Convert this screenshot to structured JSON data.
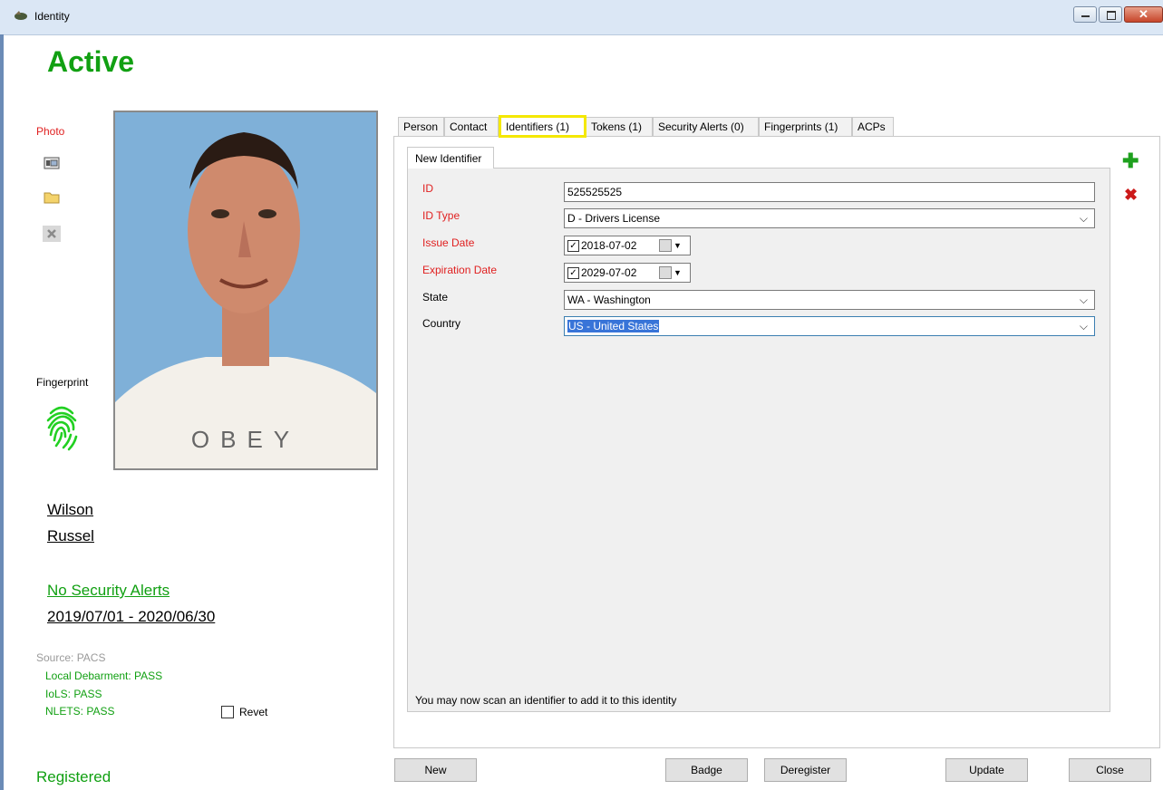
{
  "window": {
    "title": "Identity"
  },
  "status": {
    "title": "Active"
  },
  "photo": {
    "label": "Photo",
    "shirt_text": "OBEY"
  },
  "fingerprint": {
    "label": "Fingerprint"
  },
  "person": {
    "last_name": "Wilson",
    "first_name": "Russel"
  },
  "alerts": {
    "link_text": "No Security Alerts"
  },
  "validity": {
    "range": "2019/07/01  -  2020/06/30"
  },
  "checks": {
    "source": "Source: PACS",
    "local_debarment": "Local Debarment: PASS",
    "iols": "IoLS: PASS",
    "nlets": "NLETS: PASS",
    "revet_label": "Revet"
  },
  "registration": {
    "status": "Registered"
  },
  "tabs": [
    {
      "label": "Person"
    },
    {
      "label": "Contact"
    },
    {
      "label": "Identifiers (1)"
    },
    {
      "label": "Tokens (1)"
    },
    {
      "label": "Security Alerts (0)"
    },
    {
      "label": "Fingerprints (1)"
    },
    {
      "label": "ACPs"
    }
  ],
  "subtab": {
    "label": "New Identifier"
  },
  "identifier": {
    "id_label": "ID",
    "id_value": "525525525",
    "id_type_label": "ID Type",
    "id_type_value": "D - Drivers License",
    "issue_label": "Issue Date",
    "issue_value": "2018-07-02",
    "expiration_label": "Expiration Date",
    "expiration_value": "2029-07-02",
    "state_label": "State",
    "state_value": "WA - Washington",
    "country_label": "Country",
    "country_value": "US - United States"
  },
  "scan_message": "You may now scan an identifier to add it to this identity",
  "buttons": {
    "new": "New",
    "badge": "Badge",
    "deregister": "Deregister",
    "update": "Update",
    "close": "Close"
  },
  "colors": {
    "status_green": "#11a012",
    "required_red": "#e02020",
    "tab_highlight": "#f4e800"
  }
}
